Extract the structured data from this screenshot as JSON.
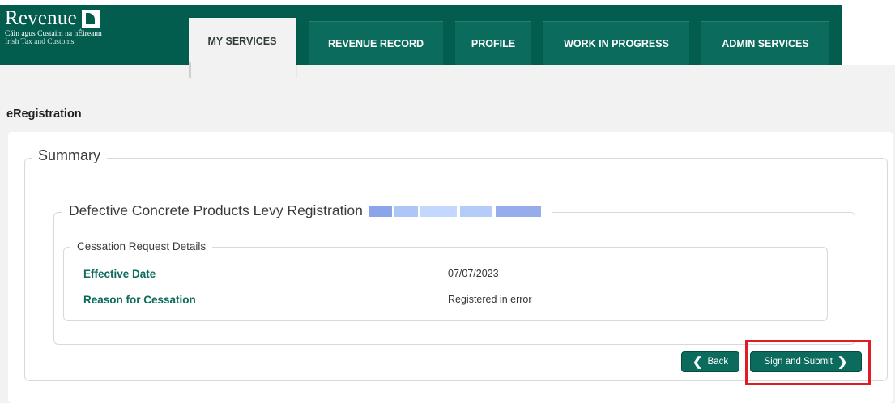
{
  "brand": {
    "name": "Revenue",
    "subtitle_irish": "Cáin agus Custaim na hÉireann",
    "subtitle_english": "Irish Tax and Customs"
  },
  "tabs": [
    {
      "label": "MY SERVICES",
      "active": true
    },
    {
      "label": "REVENUE RECORD",
      "active": false
    },
    {
      "label": "PROFILE",
      "active": false
    },
    {
      "label": "WORK IN PROGRESS",
      "active": false
    },
    {
      "label": "ADMIN SERVICES",
      "active": false
    }
  ],
  "page": {
    "heading": "eRegistration"
  },
  "summary": {
    "legend": "Summary",
    "registration": {
      "legend": "Defective Concrete Products Levy Registration"
    },
    "cessation": {
      "legend": "Cessation Request Details",
      "rows": [
        {
          "label": "Effective Date",
          "value": "07/07/2023"
        },
        {
          "label": "Reason for Cessation",
          "value": "Registered in error"
        }
      ]
    }
  },
  "actions": {
    "back_label": "Back",
    "submit_label": "Sign and Submit"
  },
  "colors": {
    "brand_green": "#035d4f",
    "button_green": "#0b6b5c",
    "highlight_red": "#e01b24"
  },
  "icons": {
    "back": "chevron-left-icon",
    "submit": "chevron-right-icon",
    "logo": "harp-icon"
  }
}
